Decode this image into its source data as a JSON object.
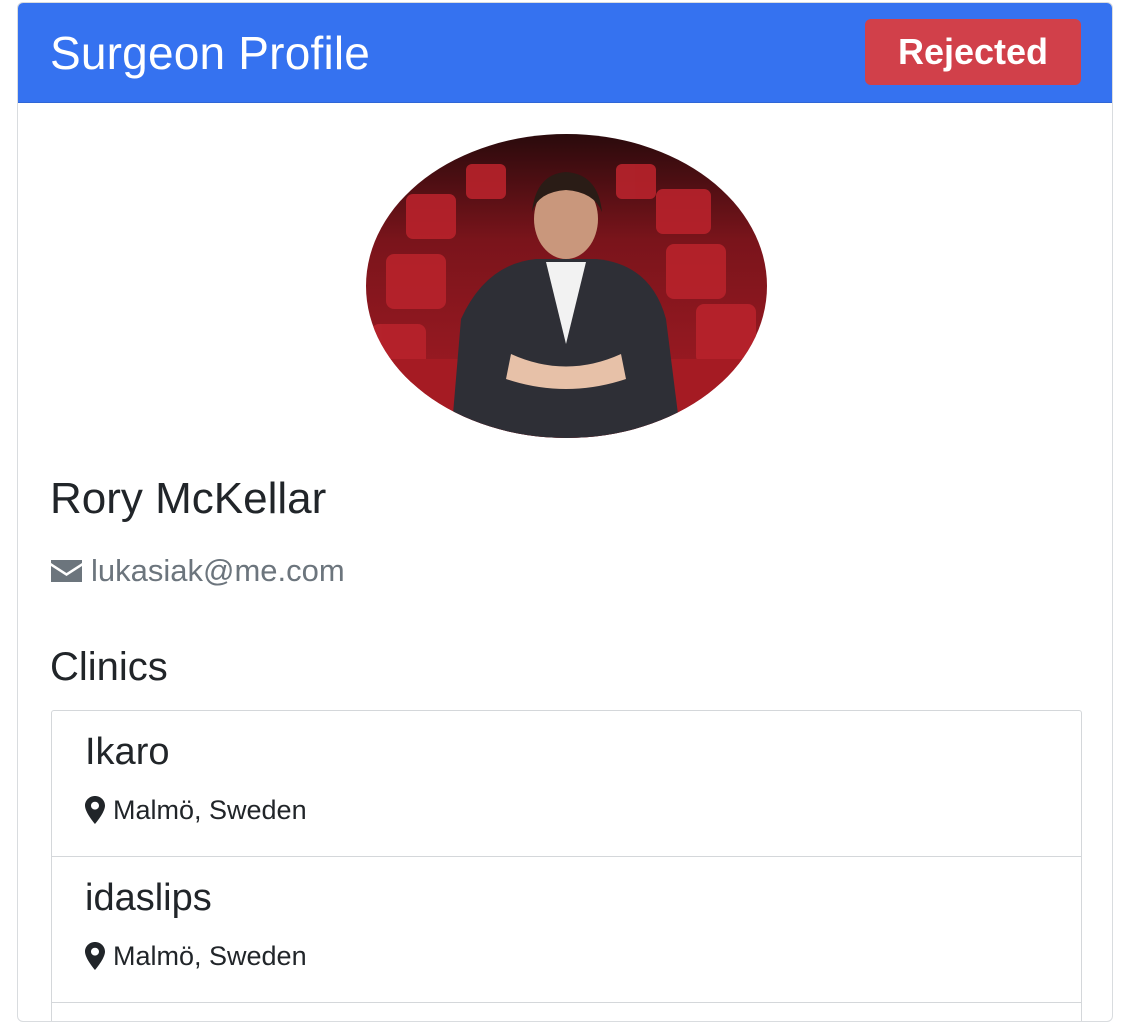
{
  "header": {
    "title": "Surgeon Profile",
    "status": "Rejected",
    "status_color": "#d1404a",
    "accent_color": "#3572f0"
  },
  "profile": {
    "name": "Rory McKellar",
    "email": "lukasiak@me.com",
    "email_icon": "envelope-icon"
  },
  "clinics": {
    "title": "Clinics",
    "location_icon": "map-pin-icon",
    "items": [
      {
        "name": "Ikaro",
        "location": "Malmö, Sweden"
      },
      {
        "name": "idaslips",
        "location": "Malmö, Sweden"
      }
    ]
  }
}
